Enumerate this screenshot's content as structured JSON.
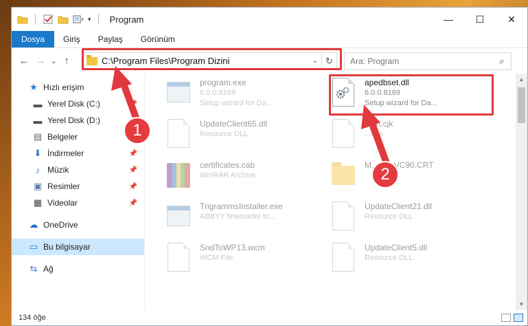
{
  "window": {
    "title": "Program"
  },
  "controls": {
    "minimize": "—",
    "maximize": "☐",
    "close": "✕"
  },
  "ribbon": {
    "tabs": [
      "Dosya",
      "Giriş",
      "Paylaş",
      "Görünüm"
    ]
  },
  "nav": {
    "back": "←",
    "forward": "→",
    "recent": "⌄",
    "up": "↑"
  },
  "address": {
    "path": "C:\\Program Files\\Program Dizini",
    "dropdown": "⌄",
    "refresh": "↻"
  },
  "search": {
    "placeholder": "Ara: Program",
    "icon": "⌕"
  },
  "sidebar": {
    "items": [
      {
        "label": "Hızlı erişim",
        "icon": "star-icon",
        "glyph": "★"
      },
      {
        "label": "Yerel Disk (C:)",
        "icon": "drive-icon",
        "glyph": "▬"
      },
      {
        "label": "Yerel Disk (D:)",
        "icon": "drive-icon",
        "glyph": "▬"
      },
      {
        "label": "Belgeler",
        "icon": "documents-icon",
        "glyph": "▤"
      },
      {
        "label": "İndirmeler",
        "icon": "download-icon",
        "glyph": "⬇"
      },
      {
        "label": "Müzik",
        "icon": "music-icon",
        "glyph": "♪"
      },
      {
        "label": "Resimler",
        "icon": "pictures-icon",
        "glyph": "▣"
      },
      {
        "label": "Videolar",
        "icon": "video-icon",
        "glyph": "▦"
      },
      {
        "label": "OneDrive",
        "icon": "cloud-icon",
        "glyph": "☁"
      },
      {
        "label": "Bu bilgisayar",
        "icon": "computer-icon",
        "glyph": "▭"
      },
      {
        "label": "Ağ",
        "icon": "network-icon",
        "glyph": "⇆"
      }
    ],
    "pin": "📌"
  },
  "files": [
    {
      "name": "program.exe",
      "line2": "6.0.0.8169",
      "line3": "Setup wizard for Da..."
    },
    {
      "name": "apedbset.dll",
      "line2": "6.0.0.8169",
      "line3": "Setup wizard for Da..."
    },
    {
      "name": "UpdateClient65.dll",
      "line2": "Resource DLL",
      "line3": ""
    },
    {
      "name": "...an.cjk",
      "line2": "...File",
      "line3": ""
    },
    {
      "name": "certificates.cab",
      "line2": "WinRAR Archive",
      "line3": ""
    },
    {
      "name": "M...soft.VC90.CRT",
      "line2": "",
      "line3": ""
    },
    {
      "name": "TrigrammsInstaller.exe",
      "line2": "ABBYY finereader tri...",
      "line3": ""
    },
    {
      "name": "UpdateClient21.dll",
      "line2": "Resource DLL",
      "line3": ""
    },
    {
      "name": "SndToWP13.wcm",
      "line2": "WCM File",
      "line3": ""
    },
    {
      "name": "UpdateClient5.dll",
      "line2": "Resource DLL",
      "line3": ""
    }
  ],
  "callouts": {
    "one": "1",
    "two": "2"
  },
  "status": {
    "count": "134 öğe"
  },
  "colors": {
    "accent": "#1979ca",
    "highlight": "#e0393e",
    "selected": "#cce8ff"
  }
}
